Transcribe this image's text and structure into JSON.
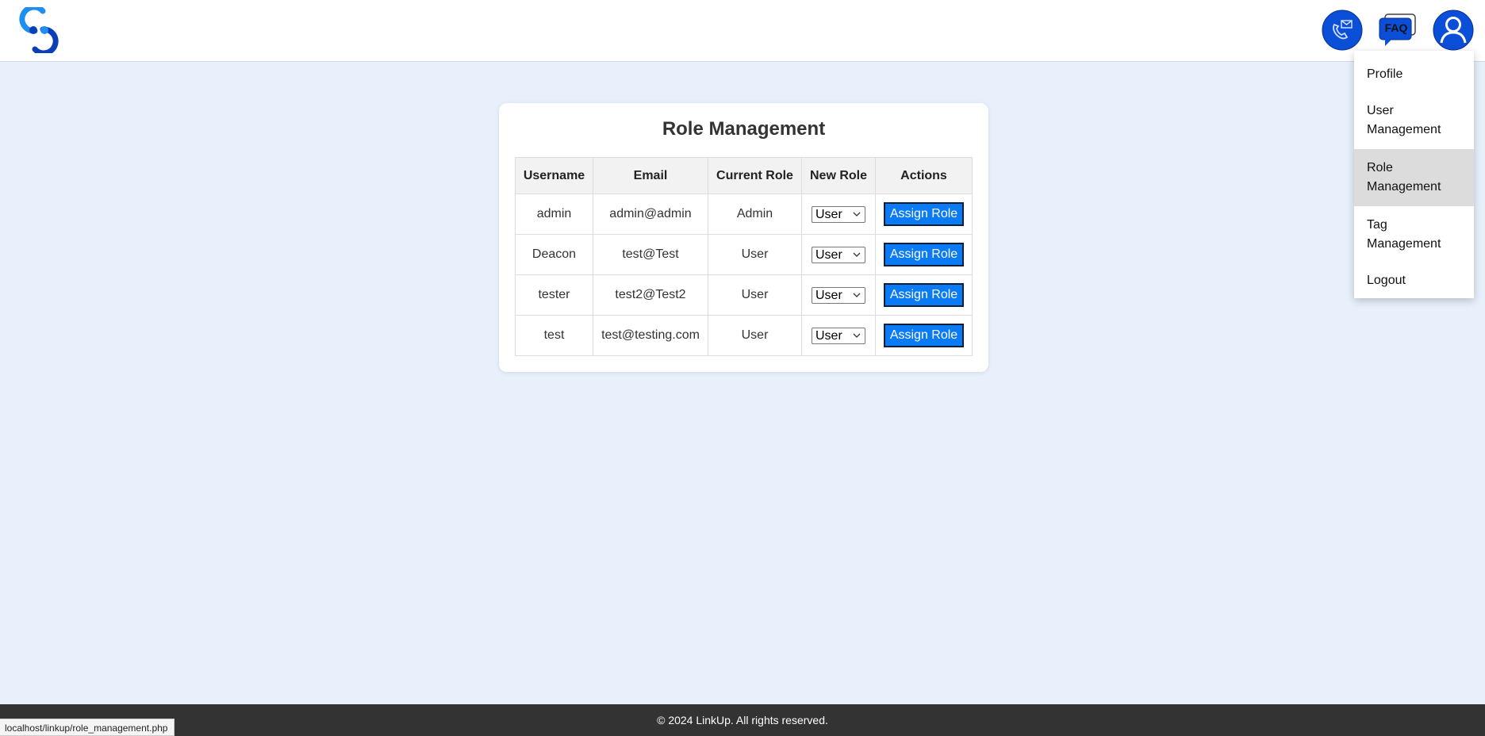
{
  "header": {
    "logo_icon": "linkup-logo-icon",
    "contact_icon": "phone-envelope-icon",
    "faq_label": "FAQ",
    "profile_icon": "user-avatar-icon",
    "accent_color": "#0b4ed8"
  },
  "dropdown": {
    "items": [
      {
        "line1": "Profile",
        "line2": ""
      },
      {
        "line1": "User",
        "line2": "Management"
      },
      {
        "line1": "Role",
        "line2": "Management",
        "active": true
      },
      {
        "line1": "Tag",
        "line2": "Management"
      },
      {
        "line1": "Logout",
        "line2": ""
      }
    ]
  },
  "main": {
    "title": "Role Management",
    "columns": [
      "Username",
      "Email",
      "Current Role",
      "New Role",
      "Actions"
    ],
    "rows": [
      {
        "username": "admin",
        "email": "admin@admin",
        "current_role": "Admin",
        "new_role": "User",
        "action": "Assign Role"
      },
      {
        "username": "Deacon",
        "email": "test@Test",
        "current_role": "User",
        "new_role": "User",
        "action": "Assign Role"
      },
      {
        "username": "tester",
        "email": "test2@Test2",
        "current_role": "User",
        "new_role": "User",
        "action": "Assign Role"
      },
      {
        "username": "test",
        "email": "test@testing.com",
        "current_role": "User",
        "new_role": "User",
        "action": "Assign Role"
      }
    ],
    "button_color": "#0a7bf5"
  },
  "footer": {
    "text": "© 2024 LinkUp. All rights reserved."
  },
  "status_bar": {
    "url": "localhost/linkup/role_management.php"
  }
}
